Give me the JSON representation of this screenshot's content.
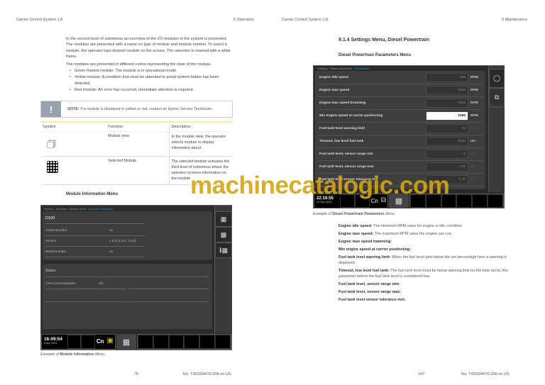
{
  "left": {
    "header_left": "Carrier Control System 1.8",
    "header_right": "6 Operation",
    "intro": "In the second level of submenus an overview of the I/O modules in the system is presented. The modules are presented with a name on type of module and module number. To select a module, the operator taps desired module on the screen. The selection is marked with a white frame.",
    "colors_intro": "The modules are presented in different colors representing the state of the module.",
    "bullets": [
      "Green framed module: The module is in operational mode.",
      "Yellow module: A condition that must be attended to avoid system failure has been detected.",
      "Red module: An error has occurred, immediate attention is required."
    ],
    "note_icon": "!",
    "note_label": "NOTE:",
    "note_text": "If a module is displayed in yellow or red, contact an Epiroc Service Technician.",
    "table": {
      "headers": [
        "Symbol",
        "Function",
        "Description"
      ],
      "rows": [
        {
          "icon": "module-view-icon",
          "function": "Module view",
          "description": "In the module view, the operator selects module to display information about."
        },
        {
          "icon": "selected-module-icon",
          "function": "Selected Module",
          "description": "The selected module activates the third level of submenus where the operator receives information on the module."
        }
      ]
    },
    "section_title": "Module Information Menu",
    "screen": {
      "breadcrumb": "System - Modules - Module D100 - ",
      "breadcrumb_active": "Module Information",
      "module": "D100",
      "fields": [
        {
          "label": "Article Number",
          "value": "na"
        },
        {
          "label": "Version",
          "value": "1.6.0 (1.4.0, 1.6.0)"
        },
        {
          "label": "Serial Number",
          "value": "na"
        }
      ],
      "status_title": "Status",
      "status": [
        {
          "label": "CAN Communication",
          "value": "OK"
        }
      ],
      "time": "16:09:54",
      "date": "6 Apr 2023",
      "cn": "Cn"
    },
    "caption_prefix": "Example of",
    "caption_bold": "Module Information",
    "caption_suffix": "Menu",
    "page_number": "75",
    "doc_number": "No: TIS0004476.008 en-US"
  },
  "right": {
    "header_left": "Carrier Control System 1.8",
    "header_right": "9 Maintenance",
    "heading": "9.1.4 Settings Menu, Diesel Powertrain",
    "subheading": "Diesel Powertrain Parameters Menu",
    "screen": {
      "breadcrumb": "Settings - Diesel powertrain - ",
      "breadcrumb_active": "Parameters",
      "params": [
        {
          "label": "Engine idle speed",
          "value": "800",
          "unit": "RPM"
        },
        {
          "label": "Engine max speed",
          "value": "2300",
          "unit": "RPM"
        },
        {
          "label": "Engine max speed tramming",
          "value": "2300",
          "unit": "RPM"
        },
        {
          "label": "Min engine speed at carrier positioning",
          "value": "1200",
          "unit": "RPM"
        },
        {
          "label": "Fuel tank level warning limit",
          "value": "10",
          "unit": "%"
        },
        {
          "label": "Timeout, low level fuel tank",
          "value": "2000",
          "unit": "ms"
        },
        {
          "label": "Fuel tank level, sensor range min",
          "value": "0",
          "unit": "%"
        },
        {
          "label": "Fuel tank level, sensor range max",
          "value": "100",
          "unit": "%"
        },
        {
          "label": "Fuel tank level sensor tolerance min",
          "value": "0.10",
          "unit": "V"
        }
      ],
      "time": "22:16:55",
      "date": "13 Dec 2022",
      "cn": "Cn"
    },
    "caption_prefix": "Example of",
    "caption_bold": "Diesel Powertrain Parameters",
    "caption_suffix": "Menu",
    "descriptions": [
      {
        "term": "Engine idle speed:",
        "text": "The minimum RPM value for engine in idle condition."
      },
      {
        "term": "Engine max speed:",
        "text": "The maximum RPM value the engine can run."
      },
      {
        "term": "Engine max speed tramming:",
        "text": ""
      },
      {
        "term": "Min engine speed at carrier positioning:",
        "text": ""
      },
      {
        "term": "Fuel tank level warning limit:",
        "text": "When the fuel level gets below the set percentage here a warning is displayed."
      },
      {
        "term": "Timeout, low level fuel tank:",
        "text": "The fuel tank level must be below warning limit for the time set by this parameter before the fuel tank level is considered low."
      },
      {
        "term": "Fuel tank level, sensor range min:",
        "text": ""
      },
      {
        "term": "Fuel tank level, sensor range max:",
        "text": ""
      },
      {
        "term": "Fuel tank level sensor tolerance min:",
        "text": ""
      }
    ],
    "page_number": "147",
    "doc_number": "No: TIS0004476.008 en-US"
  },
  "watermark": "machinecatalogic.com",
  "colors": {
    "accent": "#1e9be0",
    "watermark": "#d4a514"
  }
}
